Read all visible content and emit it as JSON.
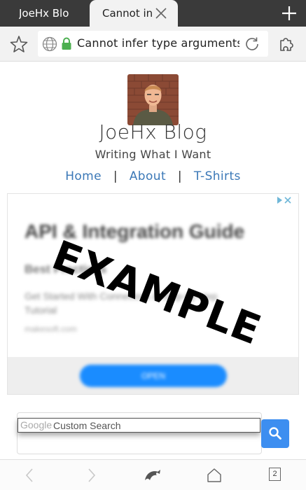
{
  "tabs": [
    {
      "label": "JoeHx Blo",
      "active": false
    },
    {
      "label": "Cannot in",
      "active": true
    }
  ],
  "toolbar": {
    "url_text": "Cannot infer type arguments ..."
  },
  "site": {
    "title": "JoeHx Blog",
    "tagline": "Writing What I Want",
    "nav": [
      {
        "label": "Home"
      },
      {
        "label": "About"
      },
      {
        "label": "T-Shirts"
      }
    ],
    "nav_separator": "|"
  },
  "ad": {
    "headline": "API & Integration Guide",
    "subhead": "Best Practices",
    "description": "Get Started With Connectors & Step-by-step Tutorial",
    "domain": "makesoft.com",
    "cta": "OPEN",
    "overlay_stamp": "EXAMPLE"
  },
  "search": {
    "brand": "Google",
    "placeholder": "Custom Search"
  },
  "bottombar": {
    "tab_count": "2"
  },
  "colors": {
    "tabstrip": "#3a3a3a",
    "link": "#3b78b7",
    "search_button": "#3d8ef0",
    "ad_button": "#1a8cff",
    "lock": "#4caf50"
  },
  "icons": [
    "close-icon",
    "new-tab-icon",
    "bookmark-star-icon",
    "globe-icon",
    "lock-icon",
    "reload-icon",
    "extensions-icon",
    "adchoices-icon",
    "search-icon",
    "back-icon",
    "forward-icon",
    "dolphin-home-icon",
    "home-icon",
    "tab-count-icon"
  ]
}
